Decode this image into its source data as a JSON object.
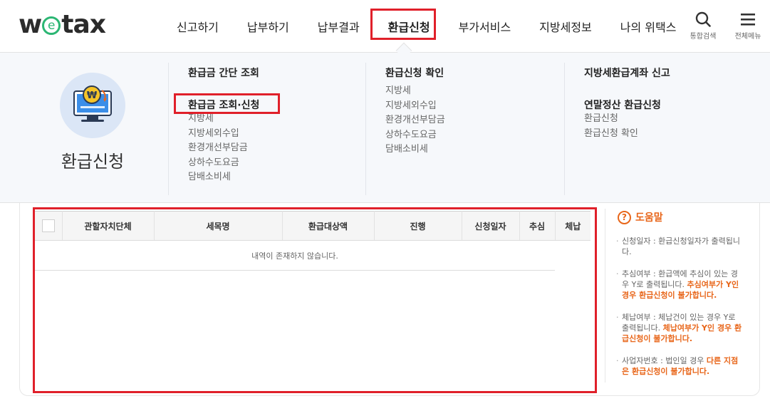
{
  "header": {
    "logo": {
      "prefix": "w",
      "e": "e",
      "suffix": "tax"
    },
    "nav": [
      {
        "label": "신고하기"
      },
      {
        "label": "납부하기"
      },
      {
        "label": "납부결과"
      },
      {
        "label": "환급신청"
      },
      {
        "label": "부가서비스"
      },
      {
        "label": "지방세정보"
      },
      {
        "label": "나의 위택스"
      }
    ],
    "search_label": "통합검색",
    "menu_label": "전체메뉴"
  },
  "mega": {
    "title": "환급신청",
    "col1": {
      "head1": "환급금 간단 조회",
      "head2": "환급금 조회·신청",
      "items": [
        "지방세",
        "지방세외수입",
        "환경개선부담금",
        "상하수도요금",
        "담배소비세"
      ]
    },
    "col2": {
      "head1": "환급신청 확인",
      "items": [
        "지방세",
        "지방세외수입",
        "환경개선부담금",
        "상하수도요금",
        "담배소비세"
      ]
    },
    "col3": {
      "head1": "지방세환급계좌 신고",
      "head2": "연말정산 환급신청",
      "items": [
        "환급신청",
        "환급신청 확인"
      ]
    }
  },
  "table": {
    "headers": [
      "관할자치단체",
      "세목명",
      "환급대상액",
      "진행",
      "신청일자",
      "추심",
      "체납"
    ],
    "empty_message": "내역이 존재하지 않습니다."
  },
  "help": {
    "title": "도움말",
    "items": [
      {
        "text": "신청일자 : 환급신청일자가 출력됩니다.",
        "warn": ""
      },
      {
        "text": "추심여부 : 환급액에 추심이 있는 경우 Y로 출력됩니다. ",
        "warn": "추심여부가 Y인 경우 환급신청이 불가합니다."
      },
      {
        "text": "체납여부 : 체납건이 있는 경우 Y로 출력됩니다. ",
        "warn": "체납여부가 Y인 경우 환급신청이 불가합니다."
      },
      {
        "text": "사업자번호 : 법인일 경우 ",
        "warn": "다른 지점은 환급신청이 불가합니다."
      }
    ]
  }
}
